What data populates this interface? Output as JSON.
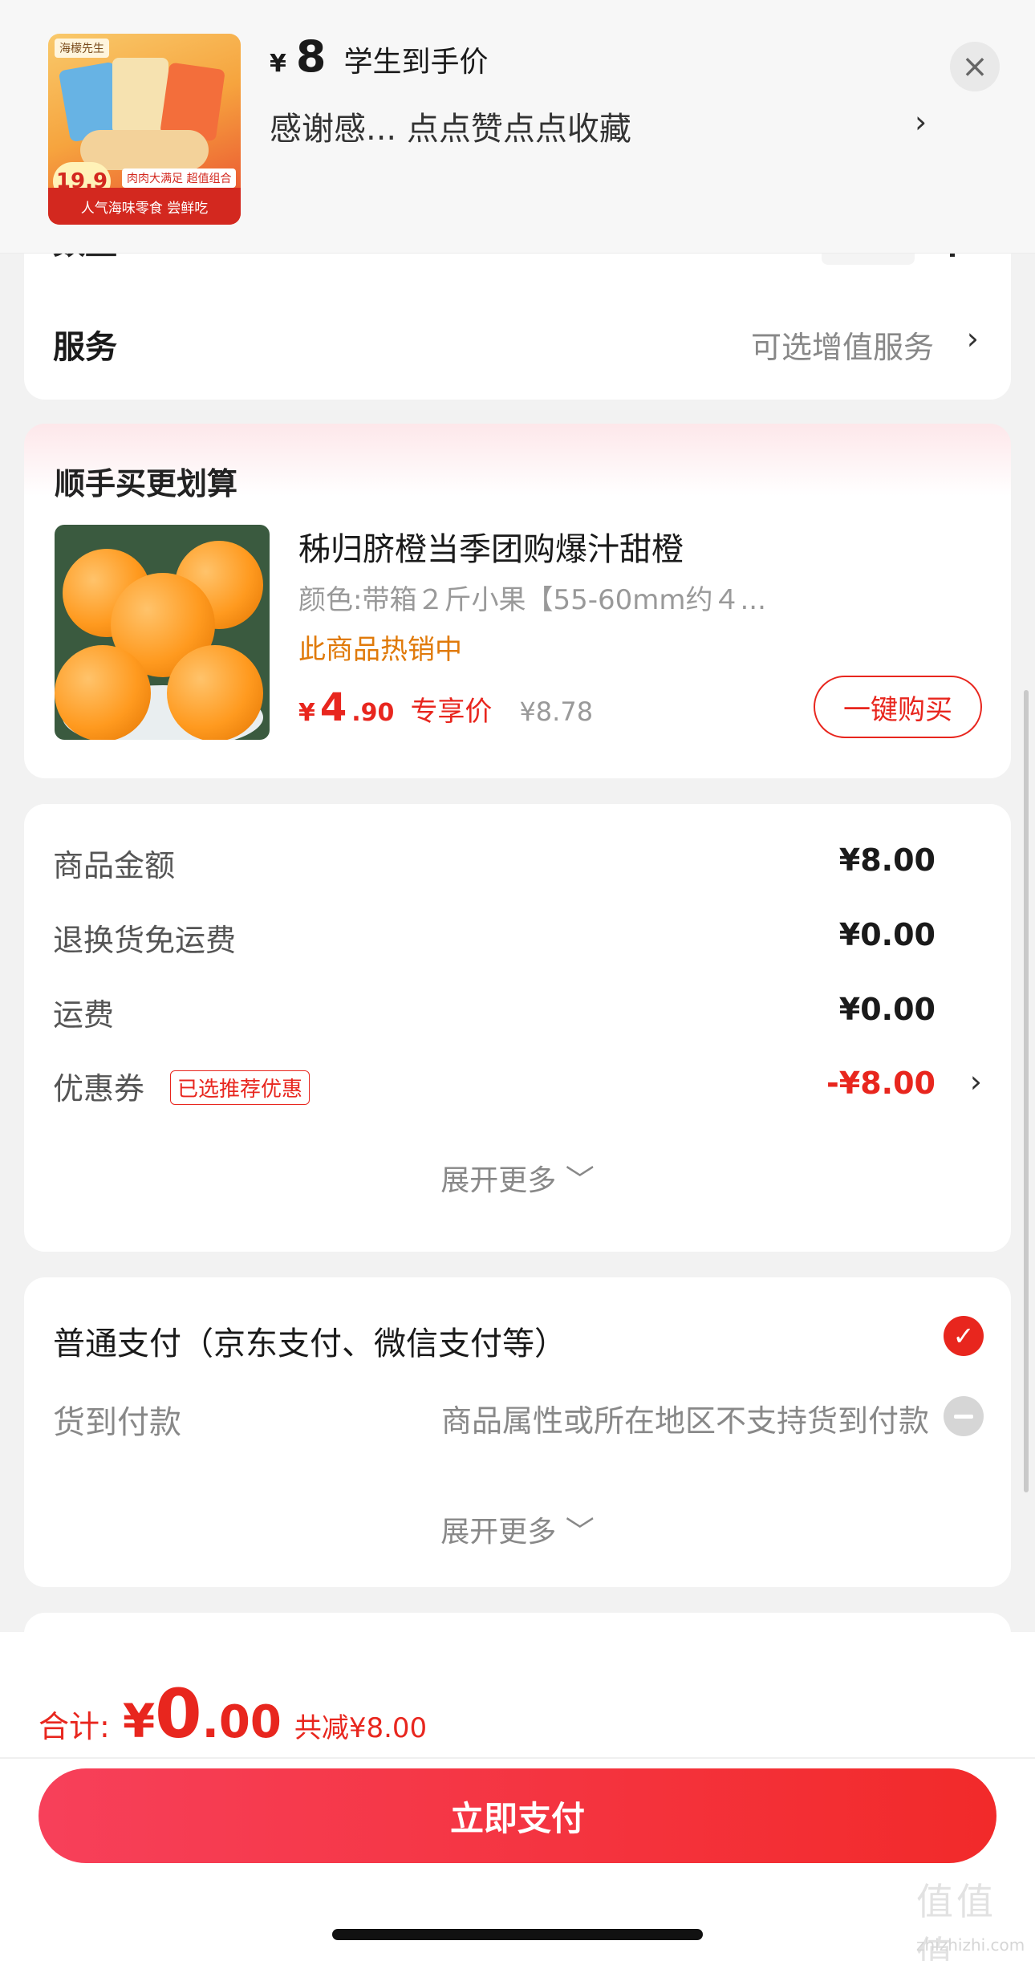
{
  "banner": {
    "thumb_brand": "海檬先生",
    "thumb_tag": "肉肉大满足 超值组合",
    "thumb_ribbon": "人气海味零食 尝鲜吃",
    "thumb_price": "19.9",
    "price_symbol": "¥",
    "price_value": "8",
    "price_label": "学生到手价",
    "subtitle": "感谢感...  点点赞点点收藏",
    "chevron": "›",
    "close": "×"
  },
  "service": {
    "qty_label": "数量",
    "label": "服务",
    "value": "可选增值服务",
    "chevron": "›"
  },
  "upsell": {
    "title": "顺手买更划算",
    "product_name": "秭归脐橙当季团购爆汁甜橙",
    "spec": "颜色:带箱２斤小果【55-60mm约４...",
    "hot": "此商品热销中",
    "price_symbol": "¥",
    "price_int": "4",
    "price_dec": ".90",
    "exclusive_label": "专享价",
    "original_price": "¥8.78",
    "buy_button": "一键购买"
  },
  "price_detail": {
    "rows": [
      {
        "label": "商品金额",
        "value": "¥8.00"
      },
      {
        "label": "退换货免运费",
        "value": "¥0.00"
      },
      {
        "label": "运费",
        "value": "¥0.00"
      },
      {
        "label": "优惠券",
        "tag": "已选推荐优惠",
        "value": "-¥8.00",
        "chevron": "›"
      }
    ],
    "expand": "展开更多 ﹀"
  },
  "payment": {
    "normal": "普通支付（京东支付、微信支付等）",
    "check": "✓",
    "cod_label": "货到付款",
    "cod_note": "商品属性或所在地区不支持货到付款",
    "expand": "展开更多 ﹀"
  },
  "footer": {
    "total_label": "合计:",
    "total_symbol": "¥",
    "total_int": "0",
    "total_dec": ".00",
    "saved": "共减¥8.00",
    "pay_button": "立即支付",
    "watermark": "值值值",
    "watermark_sub": "zhizhizhi.com"
  },
  "colors": {
    "accent": "#e8261e",
    "hot_orange": "#e07a0a",
    "background": "#f2f2f2"
  }
}
